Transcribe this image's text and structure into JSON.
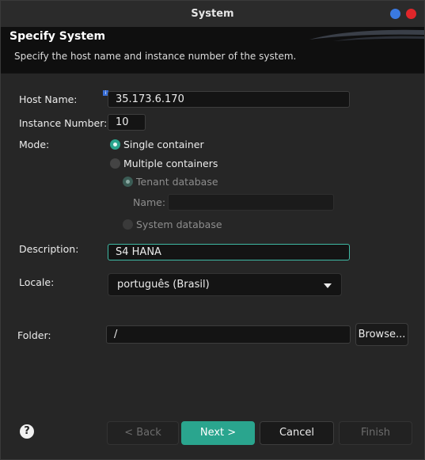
{
  "window": {
    "title": "System"
  },
  "banner": {
    "title": "Specify System",
    "subtitle": "Specify the host name and instance number of the system."
  },
  "form": {
    "host_label": "Host Name:",
    "host_value": "35.173.6.170",
    "instance_label": "Instance Number:",
    "instance_value": "10",
    "mode_label": "Mode:",
    "mode_single": "Single container",
    "mode_multiple": "Multiple containers",
    "tenant_db": "Tenant database",
    "name_label": "Name:",
    "name_value": "",
    "system_db": "System database",
    "description_label": "Description:",
    "description_value": "S4 HANA",
    "locale_label": "Locale:",
    "locale_value": "português (Brasil)",
    "folder_label": "Folder:",
    "folder_value": "/",
    "browse_label": "Browse..."
  },
  "buttons": {
    "back": "< Back",
    "next": "Next >",
    "cancel": "Cancel",
    "finish": "Finish"
  },
  "colors": {
    "accent": "#2aa58e",
    "close": "#e0262a",
    "maximize": "#3a79e0"
  }
}
